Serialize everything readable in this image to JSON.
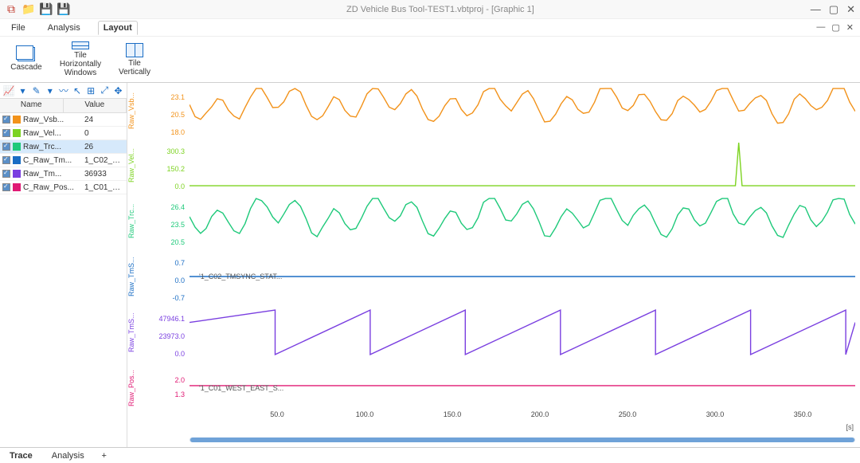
{
  "window": {
    "title": "ZD Vehicle Bus Tool-TEST1.vbtproj - [Graphic 1]"
  },
  "menu": {
    "file": "File",
    "analysis": "Analysis",
    "layout": "Layout"
  },
  "ribbon": {
    "cascade": "Cascade",
    "tile_h": "Tile\nHorizontally\nWindows",
    "tile_v": "Tile\nVertically"
  },
  "sidebar": {
    "col_name": "Name",
    "col_value": "Value",
    "rows": [
      {
        "color": "#f2921a",
        "name": "Raw_Vsb...",
        "value": "24"
      },
      {
        "color": "#7dd321",
        "name": "Raw_Vel...",
        "value": "0"
      },
      {
        "color": "#1ec97a",
        "name": "Raw_Trc...",
        "value": "26"
      },
      {
        "color": "#1a6dc4",
        "name": "C_Raw_Tm...",
        "value": "1_C02_TMSYNC_S..."
      },
      {
        "color": "#7a3fe0",
        "name": "Raw_Tm...",
        "value": "36933"
      },
      {
        "color": "#e01a74",
        "name": "C_Raw_Pos...",
        "value": "1_C01_WEST_EAS..."
      }
    ]
  },
  "strips": [
    {
      "id": "s0",
      "label": "Raw_Vsb...",
      "color": "#f2921a",
      "ticks": [
        "23.1",
        "20.5",
        "18.0"
      ],
      "annot": null
    },
    {
      "id": "s1",
      "label": "Raw_Vel...",
      "color": "#7dd321",
      "ticks": [
        "300.3",
        "150.2",
        "0.0"
      ],
      "annot": null
    },
    {
      "id": "s2",
      "label": "Raw_Trc...",
      "color": "#1ec97a",
      "ticks": [
        "26.4",
        "23.5",
        "20.5"
      ],
      "annot": null
    },
    {
      "id": "s3",
      "label": "Raw_TmS...",
      "color": "#1a6dc4",
      "ticks": [
        "0.7",
        "0.0",
        "-0.7"
      ],
      "annot": "'1_C02_TMSYNC_STAT..."
    },
    {
      "id": "s4",
      "label": "Raw_TmS...",
      "color": "#7a3fe0",
      "ticks": [
        "47946.1",
        "23973.0",
        "0.0"
      ],
      "annot": null
    },
    {
      "id": "s5",
      "label": "Raw_Pos...",
      "color": "#e01a74",
      "ticks": [
        "2.0",
        "1.3"
      ],
      "annot": "'1_C01_WEST_EAST_S..."
    }
  ],
  "x_ticks": [
    "50.0",
    "100.0",
    "150.0",
    "200.0",
    "250.0",
    "300.0",
    "350.0"
  ],
  "x_unit": "[s]",
  "status": {
    "trace": "Trace",
    "analysis": "Analysis",
    "add": "+"
  },
  "chart_data": {
    "type": "line",
    "x_range": [
      0,
      380
    ],
    "xlabel": "[s]",
    "series": [
      {
        "name": "Raw_Vsb",
        "color": "#f2921a",
        "yrange": [
          18.0,
          23.1
        ],
        "sample": [
          24,
          24,
          24,
          23,
          23,
          23,
          23,
          23,
          21,
          20,
          18,
          22,
          23,
          20,
          21,
          23,
          20,
          19,
          21,
          23,
          22,
          20,
          23,
          24,
          22,
          21,
          23,
          19,
          22,
          24,
          23,
          21,
          22,
          24,
          20,
          18,
          21,
          23,
          24,
          24,
          23
        ]
      },
      {
        "name": "Raw_Vel",
        "color": "#7dd321",
        "yrange": [
          0,
          300.3
        ],
        "sample": [
          0,
          0,
          0,
          0,
          0,
          0,
          0,
          0,
          0,
          0,
          0,
          0,
          0,
          0,
          0,
          0,
          0,
          0,
          0,
          0,
          0,
          0,
          0,
          0,
          0,
          0,
          0,
          0,
          0,
          0,
          0,
          0,
          0,
          300,
          0,
          0,
          0,
          0,
          0,
          0,
          0
        ]
      },
      {
        "name": "Raw_Trc",
        "color": "#1ec97a",
        "yrange": [
          20.5,
          26.4
        ],
        "sample": [
          25,
          25,
          25,
          24,
          26,
          23,
          25,
          24,
          22,
          21,
          23,
          25,
          26,
          22,
          24,
          25,
          22,
          21,
          24,
          26,
          25,
          23,
          26,
          26,
          24,
          23,
          25,
          22,
          24,
          26,
          25,
          23,
          24,
          26,
          22,
          21,
          24,
          26,
          26,
          26,
          25
        ]
      },
      {
        "name": "Raw_TmSync",
        "color": "#1a6dc4",
        "yrange": [
          -0.7,
          0.7
        ],
        "constant": 0.0,
        "text": "1_C02_TMSYNC_STAT"
      },
      {
        "name": "Raw_TmS2",
        "color": "#7a3fe0",
        "yrange": [
          0,
          47946.1
        ],
        "pattern": "sawtooth",
        "period": 50,
        "amplitude": 47946
      },
      {
        "name": "Raw_Pos",
        "color": "#e01a74",
        "yrange": [
          0,
          2.0
        ],
        "constant": 1.3,
        "text": "1_C01_WEST_EAST_S"
      }
    ]
  }
}
